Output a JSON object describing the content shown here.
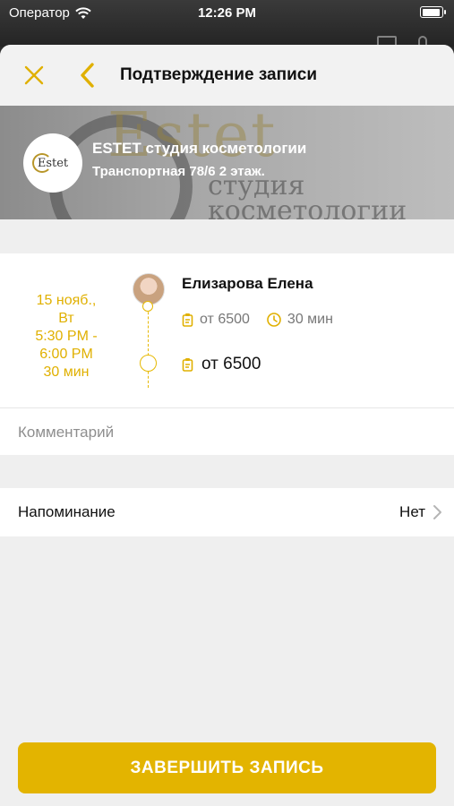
{
  "status_bar": {
    "carrier": "Оператор",
    "time": "12:26 PM"
  },
  "navbar": {
    "title": "Подтверждение записи"
  },
  "salon": {
    "logo_text": "Estet",
    "name": "ESTET студия косметологии",
    "address": "Транспортная 78/6 2 этаж.",
    "banner_word": "Estet",
    "banner_sub1": "студия",
    "banner_sub2": "косметологии"
  },
  "appointment": {
    "date_line1": "15 нояб.,",
    "date_line2": "Вт",
    "time_start": "5:30 PM -",
    "time_end": "6:00 PM",
    "duration": "30 мин",
    "master_name": "Елизарова Елена",
    "price": "от 6500",
    "service_duration": "30 мин",
    "total": "от 6500"
  },
  "comment": {
    "placeholder": "Комментарий",
    "value": ""
  },
  "reminder": {
    "label": "Напоминание",
    "value": "Нет"
  },
  "actions": {
    "finish_label": "ЗАВЕРШИТЬ ЗАПИСЬ"
  },
  "colors": {
    "accent": "#e3b400",
    "background": "#efefef"
  }
}
